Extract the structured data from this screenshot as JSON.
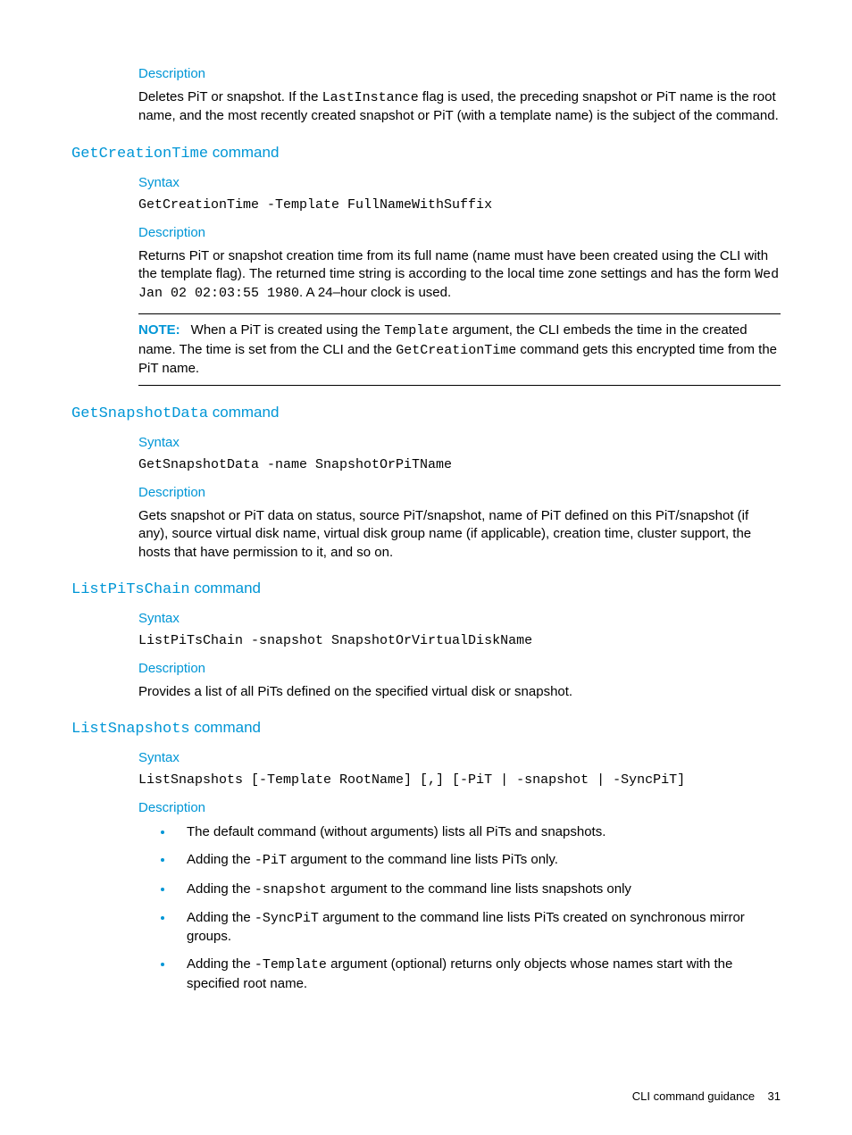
{
  "sec0": {
    "desc_label": "Description",
    "desc_p1a": "Deletes PiT or snapshot. If the ",
    "desc_p1b": "LastInstance",
    "desc_p1c": " flag is used, the preceding snapshot or PiT name is the root name, and the most recently created snapshot or PiT (with a template name) is the subject of the command."
  },
  "sec1": {
    "heading_code": "GetCreationTime",
    "heading_suffix": " command",
    "syntax_label": "Syntax",
    "syntax_line": "GetCreationTime -Template FullNameWithSuffix",
    "desc_label": "Description",
    "desc_p1a": "Returns PiT or snapshot creation time from its full name (name must have been created using the CLI with the template flag). The returned time string is according to the local time zone settings and has the form ",
    "desc_p1b": "Wed Jan 02 02:03:55 1980",
    "desc_p1c": ". A 24–hour clock is used.",
    "note_label": "NOTE:",
    "note_a": "When a PiT is created using the ",
    "note_b": "Template",
    "note_c": " argument, the CLI embeds the time in the created name. The time is set from the CLI and the ",
    "note_d": "GetCreationTime",
    "note_e": " command gets this encrypted time from the PiT name."
  },
  "sec2": {
    "heading_code": "GetSnapshotData",
    "heading_suffix": " command",
    "syntax_label": "Syntax",
    "syntax_line": "GetSnapshotData -name SnapshotOrPiTName",
    "desc_label": "Description",
    "desc_p1": "Gets snapshot or PiT data on status, source PiT/snapshot, name of PiT defined on this PiT/snapshot (if any), source virtual disk name, virtual disk group name (if applicable), creation time, cluster support, the hosts that have permission to it, and so on."
  },
  "sec3": {
    "heading_code": "ListPiTsChain",
    "heading_suffix": " command",
    "syntax_label": "Syntax",
    "syntax_line": "ListPiTsChain -snapshot SnapshotOrVirtualDiskName",
    "desc_label": "Description",
    "desc_p1": "Provides a list of all PiTs defined on the specified virtual disk or snapshot."
  },
  "sec4": {
    "heading_code": "ListSnapshots",
    "heading_suffix": " command",
    "syntax_label": "Syntax",
    "syntax_line": "ListSnapshots [-Template RootName] [,] [-PiT | -snapshot | -SyncPiT]",
    "desc_label": "Description",
    "bullets": {
      "b0": "The default command (without arguments) lists all PiTs and snapshots.",
      "b1a": "Adding the ",
      "b1b": "-PiT",
      "b1c": " argument to the command line lists PiTs only.",
      "b2a": "Adding the ",
      "b2b": "-snapshot",
      "b2c": " argument to the command line lists snapshots only",
      "b3a": "Adding the ",
      "b3b": "-SyncPiT",
      "b3c": " argument to the command line lists PiTs created on synchronous mirror groups.",
      "b4a": "Adding the ",
      "b4b": "-Template",
      "b4c": " argument (optional) returns only objects whose names start with the specified root name."
    }
  },
  "footer": {
    "text": "CLI command guidance",
    "page": "31"
  }
}
